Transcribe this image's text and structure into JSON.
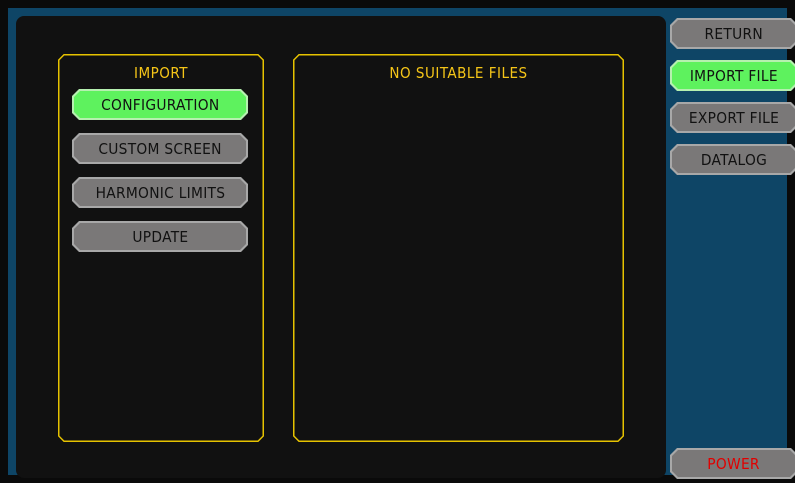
{
  "import_panel": {
    "title": "IMPORT",
    "buttons": [
      {
        "label": "CONFIGURATION",
        "active": true
      },
      {
        "label": "CUSTOM SCREEN",
        "active": false
      },
      {
        "label": "HARMONIC LIMITS",
        "active": false
      },
      {
        "label": "UPDATE",
        "active": false
      }
    ]
  },
  "files_panel": {
    "title": "NO SUITABLE FILES"
  },
  "side_menu": {
    "items": [
      {
        "label": "RETURN",
        "active": false
      },
      {
        "label": "IMPORT FILE",
        "active": true
      },
      {
        "label": "EXPORT FILE",
        "active": false
      },
      {
        "label": "DATALOG",
        "active": false
      }
    ],
    "power_label": "POWER"
  },
  "colors": {
    "background": "#0e4566",
    "panel": "#111111",
    "accent_yellow": "#f5c518",
    "active_green": "#5ef25e",
    "button_grey": "#7a7878",
    "power_red": "#e00000"
  }
}
